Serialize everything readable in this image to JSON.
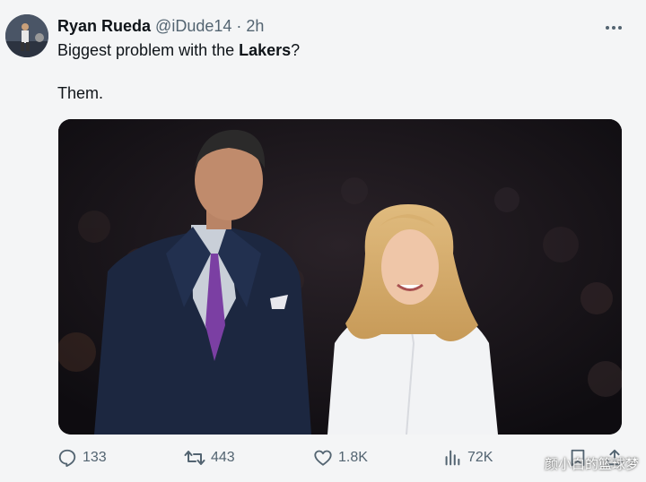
{
  "tweet": {
    "author_name": "Ryan Rueda",
    "author_handle": "@iDude14",
    "separator": "·",
    "time": "2h",
    "text_prefix": "Biggest problem with the ",
    "text_bold": "Lakers",
    "text_suffix": "?",
    "text_line2": "Them."
  },
  "icons": {
    "more": "more-horizontal-icon",
    "reply": "reply-icon",
    "retweet": "retweet-icon",
    "like": "heart-icon",
    "views": "views-bar-icon",
    "bookmark": "bookmark-icon",
    "share": "share-icon"
  },
  "actions": {
    "replies": "133",
    "retweets": "443",
    "likes": "1.8K",
    "views": "72K"
  },
  "watermark": "颜小白的篮球梦",
  "colors": {
    "text_primary": "#0f1419",
    "text_secondary": "#536471",
    "background": "#f4f5f6",
    "tie_purple": "#7b3fa3"
  }
}
